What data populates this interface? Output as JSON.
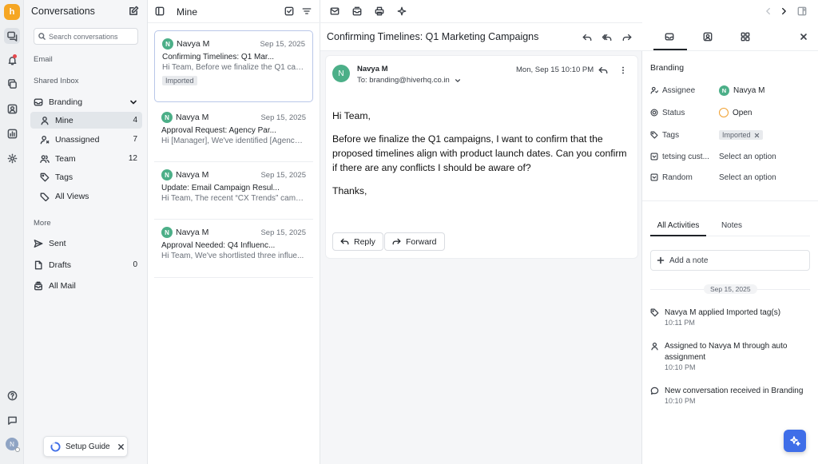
{
  "sidebar": {
    "title": "Conversations",
    "search_placeholder": "Search conversations",
    "email_section": "Email",
    "shared_inbox_section": "Shared Inbox",
    "inbox_name": "Branding",
    "items": [
      {
        "label": "Mine",
        "count": "4"
      },
      {
        "label": "Unassigned",
        "count": "7"
      },
      {
        "label": "Team",
        "count": "12"
      },
      {
        "label": "Tags",
        "count": ""
      },
      {
        "label": "All Views",
        "count": ""
      }
    ],
    "more_section": "More",
    "more_items": [
      {
        "label": "Sent",
        "count": ""
      },
      {
        "label": "Drafts",
        "count": "0"
      },
      {
        "label": "All Mail",
        "count": ""
      }
    ],
    "setup_guide": "Setup Guide",
    "user_initial": "N"
  },
  "list": {
    "title": "Mine",
    "conversations": [
      {
        "avatar": "N",
        "sender": "Navya M",
        "date": "Sep 15, 2025",
        "subject": "Confirming Timelines: Q1 Mar...",
        "preview": "Hi Team, Before we finalize the Q1 cam...",
        "tag": "Imported"
      },
      {
        "avatar": "N",
        "sender": "Navya M",
        "date": "Sep 15, 2025",
        "subject": "Approval Request: Agency Par...",
        "preview": "Hi [Manager], We've identified [Agency ...",
        "tag": ""
      },
      {
        "avatar": "N",
        "sender": "Navya M",
        "date": "Sep 15, 2025",
        "subject": "Update: Email Campaign Resul...",
        "preview": "Hi Team, The recent “CX Trends” camp...",
        "tag": ""
      },
      {
        "avatar": "N",
        "sender": "Navya M",
        "date": "Sep 15, 2025",
        "subject": "Approval Needed: Q4 Influenc...",
        "preview": "Hi Team, We've shortlisted three influe...",
        "tag": ""
      }
    ]
  },
  "thread": {
    "subject": "Confirming Timelines: Q1 Marketing Campaigns",
    "message": {
      "avatar": "N",
      "sender": "Navya M",
      "to": "To: branding@hiverhq.co.in",
      "time": "Mon, Sep 15 10:10 PM",
      "greeting": "Hi Team,",
      "body": "Before we finalize the Q1 campaigns, I want to confirm that the proposed timelines align with product launch dates. Can you confirm if there are any conflicts I should be aware of?",
      "signoff": "Thanks,"
    },
    "reply_label": "Reply",
    "forward_label": "Forward"
  },
  "details": {
    "inbox": "Branding",
    "fields": {
      "assignee_label": "Assignee",
      "assignee_avatar": "N",
      "assignee_value": "Navya M",
      "status_label": "Status",
      "status_value": "Open",
      "tags_label": "Tags",
      "tag_value": "Imported",
      "custom1_label": "tetsing cust...",
      "custom1_value": "Select an option",
      "custom2_label": "Random",
      "custom2_value": "Select an option"
    },
    "tabs": {
      "activities": "All Activities",
      "notes": "Notes"
    },
    "add_note": "Add a note",
    "date_divider": "Sep 15, 2025",
    "activities": [
      {
        "text": "Navya M applied Imported tag(s)",
        "time": "10:11 PM",
        "icon": "tag-icon"
      },
      {
        "text": "Assigned to Navya M through auto assignment",
        "time": "10:10 PM",
        "icon": "user-icon"
      },
      {
        "text": "New conversation received in Branding",
        "time": "10:10 PM",
        "icon": "chat-icon"
      }
    ]
  },
  "colors": {
    "accent": "#3f6ee8",
    "brand": "#f5a623",
    "avatar": "#4caf88",
    "status_open": "#f0a030"
  }
}
